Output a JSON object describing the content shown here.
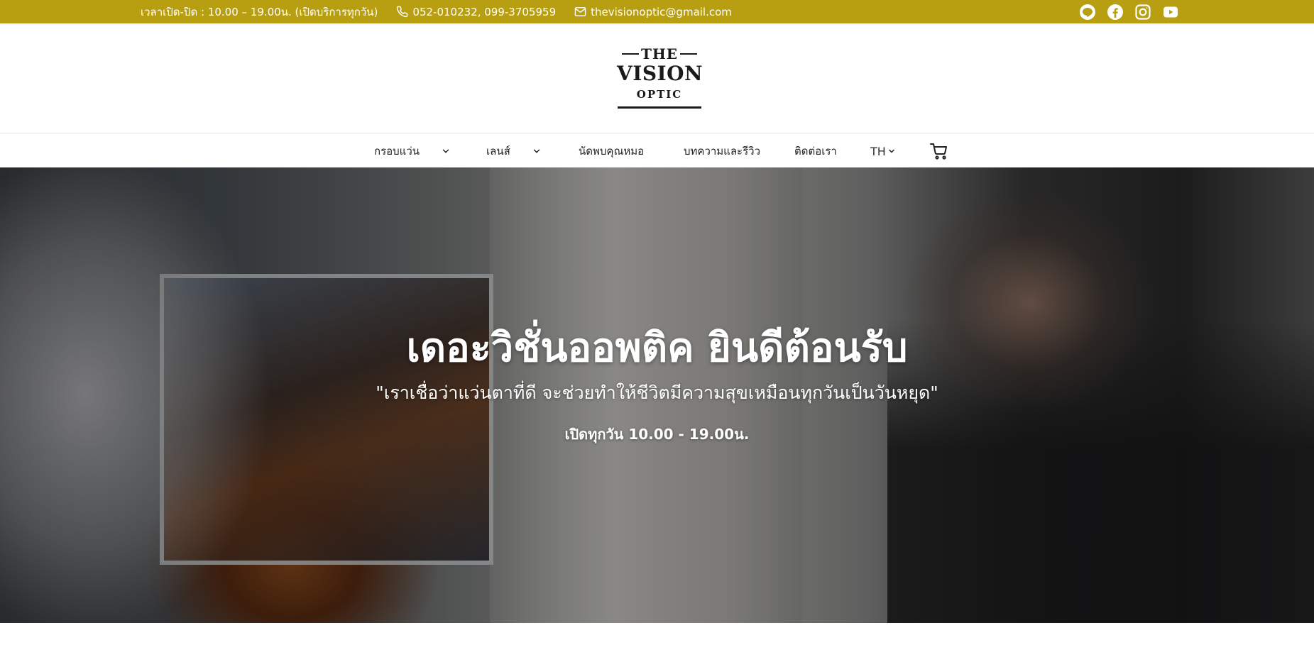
{
  "topbar": {
    "hours": "เวลาเปิด-ปิด : 10.00 – 19.00น. (เปิดบริการทุกวัน)",
    "phone": "052-010232, 099-3705959",
    "email": "thevisionoptic@gmail.com",
    "social": [
      "line-icon",
      "facebook-icon",
      "instagram-icon",
      "youtube-icon"
    ],
    "bg_color": "#b89e11"
  },
  "logo": {
    "the": "THE",
    "vision": "VISION",
    "optic": "OPTIC"
  },
  "nav": {
    "frames": "กรอบแว่น",
    "lenses": "เลนส์",
    "appointment": "นัดพบคุณหมอ",
    "articles": "บทความและรีวิว",
    "contact": "ติดต่อเรา",
    "language": "TH"
  },
  "hero": {
    "title": "เดอะวิชั่นออพติค ยินดีต้อนรับ",
    "subtitle": "\"เราเชื่อว่าแว่นตาที่ดี จะช่วยทำให้ชีวิตมีความสุขเหมือนทุกวันเป็นวันหยุด\"",
    "hours": "เปิดทุกวัน 10.00 - 19.00น."
  }
}
